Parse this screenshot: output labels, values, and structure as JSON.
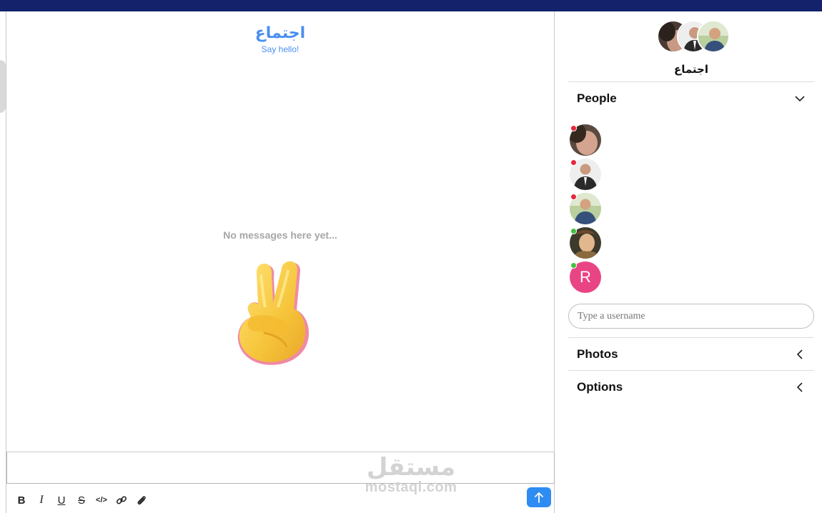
{
  "chat": {
    "title": "اجتماع",
    "subtitle": "Say hello!",
    "empty_text": "No messages here yet..."
  },
  "composer": {
    "tools": [
      {
        "icon": "bold-icon",
        "glyph": "B"
      },
      {
        "icon": "italic-icon",
        "glyph": "I"
      },
      {
        "icon": "underline-icon",
        "glyph": "U"
      },
      {
        "icon": "strikethrough-icon",
        "glyph": "S"
      },
      {
        "icon": "code-icon",
        "glyph": "</>"
      },
      {
        "icon": "link-icon",
        "glyph": "link"
      },
      {
        "icon": "attachment-icon",
        "glyph": "clip"
      }
    ],
    "send_icon": "arrow-up-icon",
    "send_color": "#2f8cf3"
  },
  "watermark": {
    "arabic": "مستقل",
    "latin": "mostaql.com"
  },
  "sidebar": {
    "group_name": "اجتماع",
    "sections": {
      "people": "People",
      "photos": "Photos",
      "options": "Options"
    },
    "members": [
      {
        "status": "offline",
        "status_color": "#e8273b"
      },
      {
        "status": "offline",
        "status_color": "#e8273b"
      },
      {
        "status": "offline",
        "status_color": "#e8273b"
      },
      {
        "status": "online",
        "status_color": "#3fc13f"
      },
      {
        "status": "online",
        "status_color": "#3fc13f",
        "initial": "R"
      }
    ],
    "username_placeholder": "Type a username"
  },
  "colors": {
    "top_bar": "#13226b",
    "accent": "#4a8ff0",
    "r_avatar": "#e94585"
  }
}
